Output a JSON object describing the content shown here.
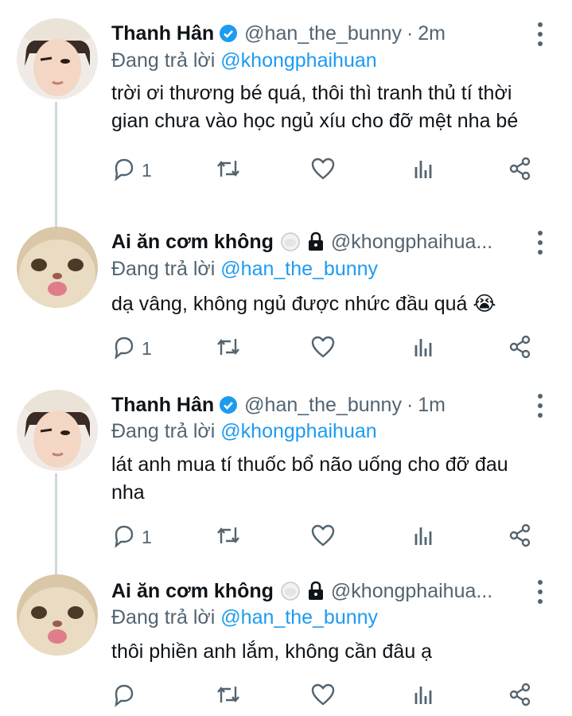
{
  "tweets": [
    {
      "name": "Thanh Hân",
      "handle": "@han_the_bunny",
      "dot": "·",
      "time": "2m",
      "replying_prefix": "Đang trả lời ",
      "replying_to": "@khongphaihuan",
      "text": "trời ơi thương bé quá, thôi thì tranh thủ tí thời gian chưa vào học ngủ xíu cho đỡ mệt nha bé",
      "reply_count": "1",
      "verified": true,
      "avatar": "boy-photo-avatar"
    },
    {
      "name": "Ai ăn cơm không",
      "handle": "@khongphaihua...",
      "dot": "",
      "time": "",
      "replying_prefix": "Đang trả lời ",
      "replying_to": "@han_the_bunny",
      "text": "dạ vâng, không ngủ được nhức đầu quá 😭",
      "reply_count": "1",
      "verified": false,
      "avatar": "cat-photo-avatar"
    },
    {
      "name": "Thanh Hân",
      "handle": "@han_the_bunny",
      "dot": "·",
      "time": "1m",
      "replying_prefix": "Đang trả lời ",
      "replying_to": "@khongphaihuan",
      "text": "lát anh mua tí thuốc bổ não uống cho đỡ đau nha",
      "reply_count": "1",
      "verified": true,
      "avatar": "boy-photo-avatar"
    },
    {
      "name": "Ai ăn cơm không",
      "handle": "@khongphaihua...",
      "dot": "",
      "time": "",
      "replying_prefix": "Đang trả lời ",
      "replying_to": "@han_the_bunny",
      "text": "thôi phiền anh lắm, không cần đâu ạ",
      "reply_count": "",
      "verified": false,
      "avatar": "cat-photo-avatar"
    }
  ],
  "colors": {
    "link": "#1d9bf0",
    "secondary": "#536471",
    "text": "#0f1419",
    "thread": "#cfd9de"
  },
  "icons": [
    "reply-icon",
    "retweet-icon",
    "like-icon",
    "analytics-icon",
    "share-icon",
    "more-icon",
    "verified-badge-icon",
    "rice-ball-icon",
    "lock-icon"
  ]
}
